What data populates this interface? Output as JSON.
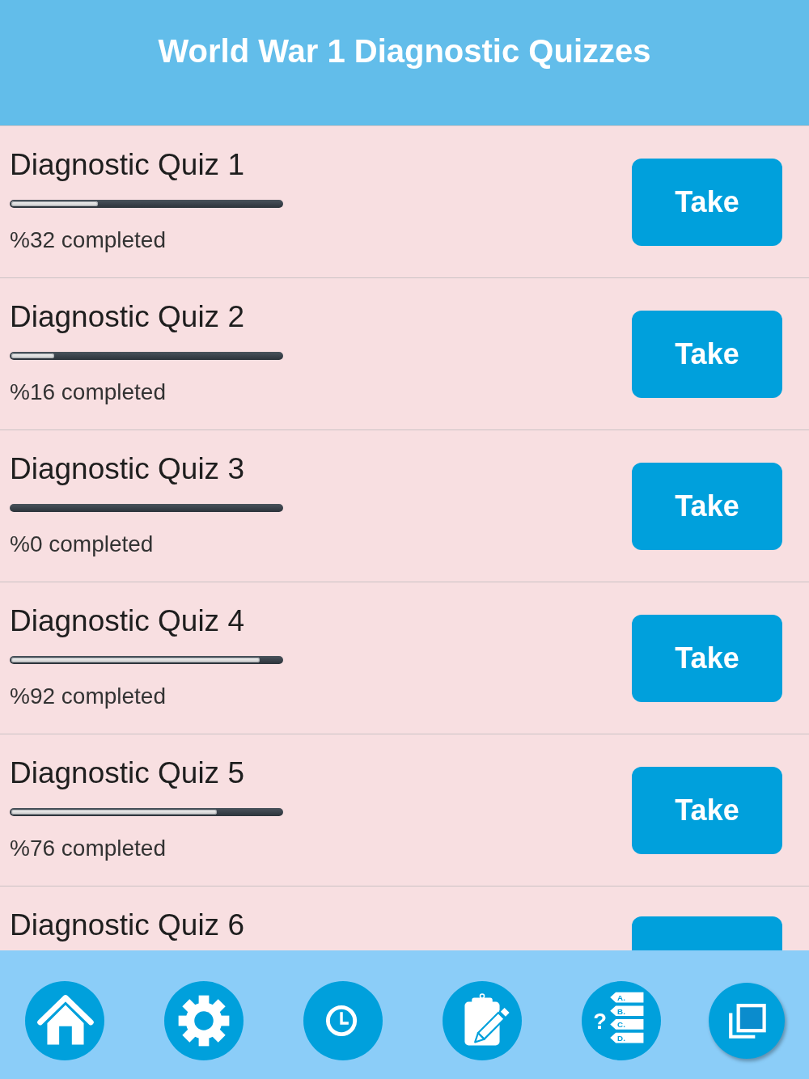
{
  "header": {
    "title": "World War 1 Diagnostic Quizzes"
  },
  "rows": [
    {
      "title": "Diagnostic Quiz 1",
      "level": 0.32,
      "status": "%32 completed",
      "button": "Take"
    },
    {
      "title": "Diagnostic Quiz 2",
      "level": 0.16,
      "status": "%16 completed",
      "button": "Take"
    },
    {
      "title": "Diagnostic Quiz 3",
      "level": 0,
      "status": "%0 completed",
      "button": "Take"
    },
    {
      "title": "Diagnostic Quiz 4",
      "level": 0.92,
      "status": "%92 completed",
      "button": "Take"
    },
    {
      "title": "Diagnostic Quiz 5",
      "level": 0.76,
      "status": "%76 completed",
      "button": "Take"
    },
    {
      "title": "Diagnostic Quiz 6"
    }
  ],
  "tab_bar": {
    "items": [
      {
        "kind": "home"
      },
      {
        "kind": "settings"
      },
      {
        "kind": "clock"
      },
      {
        "kind": "notes"
      },
      {
        "kind": "quiz",
        "mark": "?",
        "options": [
          "A.",
          "B.",
          "C.",
          "D."
        ]
      },
      {
        "kind": "copy"
      }
    ]
  }
}
